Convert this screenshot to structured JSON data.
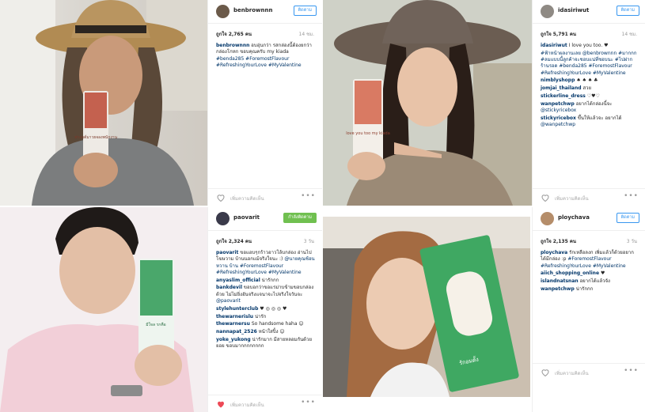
{
  "posts": [
    {
      "username": "benbrownnn",
      "follow_label": "ติดตาม",
      "likes": "ถูกใจ 2,765 คน",
      "time": "14 ชม.",
      "comments": [
        {
          "user": "benbrownnn",
          "text": "อบอุ่นกว่า รสกล่องนี้ต้องยกว่า กล่องโกหก ขอบคุณครับ my kiada",
          "tags": "#benda285 #ForemostFlavour #RefreshingYourLove #MyValentine"
        }
      ],
      "add_comment": "เพิ่มความคิดเห็น",
      "more": "•••",
      "box_text": "ฟรอยต์มาวยจองพนักงาน",
      "box_color": "#c4614f"
    },
    {
      "username": "idasiriwut",
      "follow_label": "ติดตาม",
      "likes": "ถูกใจ 5,791 คน",
      "time": "14 ชม.",
      "comments": [
        {
          "user": "idasiriwut",
          "text": "I love you too. ♥",
          "tags": ""
        },
        {
          "user": "",
          "text": "",
          "tags": "#ฟ้าหน้าผลงานเลย @benbrownnn #มากกก #ลมแบบนี้ลูกค้าจะชอบแน่ที่ชอบนะ #ไปฝากร้านรอด #benda285 #ForemostFlavour #RefreshingYourLove #MyValentine"
        },
        {
          "user": "nimblyshopp",
          "text": "♠ ♠ ♠ ♣",
          "tags": ""
        },
        {
          "user": "jomjai_thailand",
          "text": "สวย",
          "tags": ""
        },
        {
          "user": "stickerline_dress",
          "text": "♡♥♡",
          "tags": ""
        },
        {
          "user": "wanpetchwp",
          "text": "อยากได้กล่องนี้จะ",
          "tags": "@stickyricebox"
        },
        {
          "user": "stickyricebox",
          "text": "ขึ้นให้แล้วจะ อยากได้",
          "tags": "@wanpetchwp"
        }
      ],
      "add_comment": "เพิ่มความคิดเห็น",
      "more": "•••",
      "box_text": "love you too my kiada",
      "box_color": "#d97a63"
    },
    {
      "username": "paovarit",
      "follow_label": "กำลังติดตาม",
      "likes": "ถูกใจ 2,324 คน",
      "time": "3 วัน",
      "comments": [
        {
          "user": "paovarit",
          "text": "ขอแอบๆกร้าวอาวโล้บกล่อง อ่านไปโฆษวาม บ้านนอกแม้จริงใจนะ :)",
          "tags": "@นายคุณช้อนหวาน บ้าน #ForemostFlavour #RefreshingYourLove #MyValentine"
        },
        {
          "user": "anyaslim_official",
          "text": "น่ารักกก",
          "tags": ""
        },
        {
          "user": "bankdevil",
          "text": "ขอบอกว่าขอแรม่าบข้ามขอบกล่องด้วย ไม่ไม่ยิ่งอันจริงแจนาจะไปจริงใจวันจะ",
          "tags": "@paovarit"
        },
        {
          "user": "stylehunterclub",
          "text": "♥ ◎ ◎ ◎ ♥",
          "tags": ""
        },
        {
          "user": "thewarnerislu",
          "text": "น่ารัก",
          "tags": ""
        },
        {
          "user": "thewarnersu",
          "text": "So handsome haha ☺",
          "tags": ""
        },
        {
          "user": "nannapat_2526",
          "text": "หน้าใสปิ้ง ☺",
          "tags": ""
        },
        {
          "user": "yoke_yukong",
          "text": "น่ารักมาก มีสายหลอมกันด้วยยอย ขอบมากกกกกกกก",
          "tags": ""
        }
      ],
      "add_comment": "เพิ่มความคิดเห็น",
      "more": "•••",
      "box_text": "มีใจล รกคือ",
      "box_color": "#4aa76b"
    },
    {
      "username": "ploychava",
      "follow_label": "ติดตาม",
      "likes": "ถูกใจ 2,135 คน",
      "time": "3 วัน",
      "comments": [
        {
          "user": "ploychava",
          "text": "รักเหลือลงก เพิ่มแล้วก็ด้วยอยากได้มีกล่อง :p",
          "tags": "#ForemostFlavour #RefreshingYourLove #MyValentine"
        },
        {
          "user": "aiich_shopping_online",
          "text": "♥",
          "tags": ""
        },
        {
          "user": "islandnatsnan",
          "text": "อยากได้แล้วจัง",
          "tags": ""
        },
        {
          "user": "wanpetchwp",
          "text": "น่ารักกก",
          "tags": ""
        }
      ],
      "add_comment": "เพิ่มความคิดเห็น",
      "more": "•••",
      "box_text": "รักอมตั้ง",
      "box_color": "#3fa862"
    }
  ],
  "colors": {
    "accent": "#3897f0",
    "tag": "#003569",
    "following": "#70c050",
    "liked": "#ed4956"
  }
}
